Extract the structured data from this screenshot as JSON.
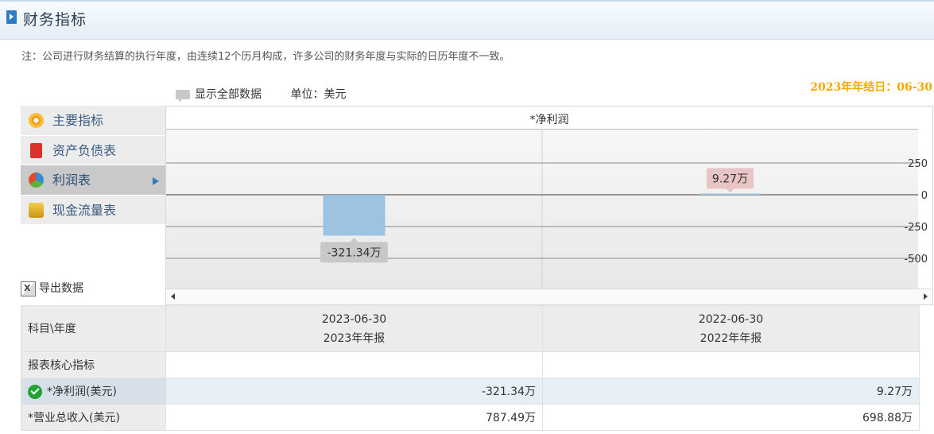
{
  "header": {
    "title": "财务指标"
  },
  "note": "注：公司进行财务结算的执行年度，由连续12个历月构成，许多公司的财务年度与实际的日历年度不一致。",
  "fiscal_year_end": "2023年年结日：06-30",
  "toolbar": {
    "show_all_label": "显示全部数据",
    "unit_label": "单位：美元"
  },
  "menu": {
    "items": [
      {
        "label": "主要指标",
        "icon": "flower-icon"
      },
      {
        "label": "资产负债表",
        "icon": "book-icon"
      },
      {
        "label": "利润表",
        "icon": "pie-chart-icon",
        "active": true
      },
      {
        "label": "现金流量表",
        "icon": "coins-icon"
      }
    ]
  },
  "export_label": "导出数据",
  "chart_data": {
    "type": "bar",
    "title": "*净利润",
    "categories": [
      "2023-06-30",
      "2022-06-30"
    ],
    "values": [
      -321.34,
      9.27
    ],
    "data_labels": [
      "-321.34万",
      "9.27万"
    ],
    "yticks": [
      "250",
      "0",
      "-250",
      "-500"
    ],
    "ylim": [
      -750,
      500
    ],
    "grid": true,
    "colors": {
      "bar": "#9dc3e0",
      "label_neg_bg": "#c8c8c8",
      "label_pos_bg": "#e8c4c4"
    }
  },
  "table": {
    "header": {
      "label": "科目\\年度",
      "col1_date": "2023-06-30",
      "col1_report": "2023年年报",
      "col2_date": "2022-06-30",
      "col2_report": "2022年年报"
    },
    "section": "报表核心指标",
    "rows": [
      {
        "label": "*净利润(美元)",
        "v1": "-321.34万",
        "v2": "9.27万"
      },
      {
        "label": "*营业总收入(美元)",
        "v1": "787.49万",
        "v2": "698.88万"
      }
    ]
  }
}
